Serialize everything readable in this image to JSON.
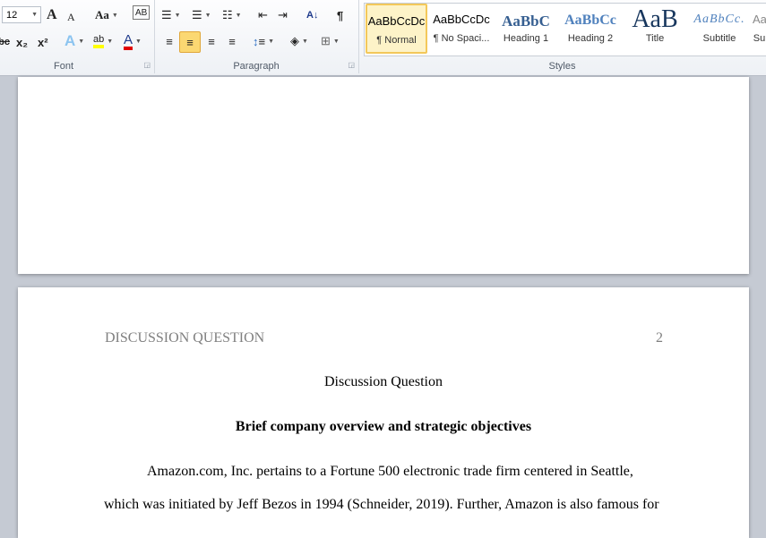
{
  "ribbon": {
    "font": {
      "label": "Font",
      "size": "12",
      "grow": "A",
      "shrink": "A",
      "change_case": "Aa",
      "strike": "abc",
      "subscript": "x₂",
      "superscript": "x²",
      "text_effects": "A",
      "highlight": "ab",
      "font_color": "A",
      "highlight_color": "#ffff00",
      "font_color_value": "#e00000"
    },
    "paragraph": {
      "label": "Paragraph",
      "pilcrow": "¶",
      "sort": "A↓"
    },
    "styles": {
      "label": "Styles",
      "items": [
        {
          "preview": "AaBbCcDc",
          "name": "¶ Normal",
          "selected": true
        },
        {
          "preview": "AaBbCcDc",
          "name": "¶ No Spaci..."
        },
        {
          "preview": "AaBbC",
          "name": "Heading 1"
        },
        {
          "preview": "AaBbCc",
          "name": "Heading 2"
        },
        {
          "preview": "AaB",
          "name": "Title"
        },
        {
          "preview": "AaBbCc.",
          "name": "Subtitle"
        },
        {
          "preview": "Aa",
          "name": "Su"
        }
      ]
    }
  },
  "document": {
    "header_left": "DISCUSSION QUESTION",
    "page_number": "2",
    "title": "Discussion Question",
    "heading": "Brief company overview and strategic objectives",
    "lines": [
      "Amazon.com, Inc. pertains to a Fortune 500 electronic trade firm centered in Seattle,",
      "which was initiated by Jeff Bezos in 1994 (Schneider, 2019). Further, Amazon is also famous for"
    ]
  }
}
